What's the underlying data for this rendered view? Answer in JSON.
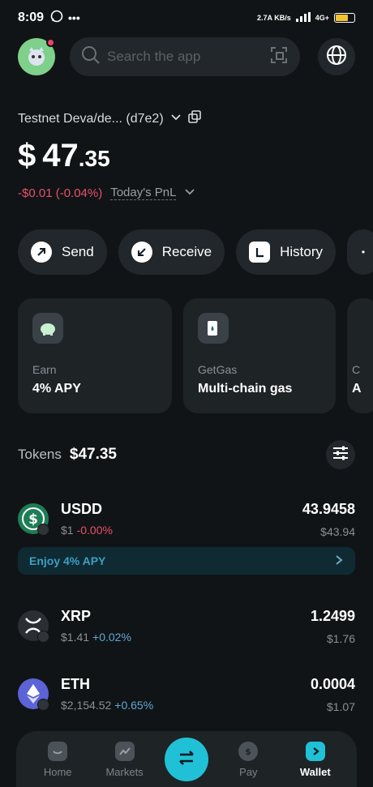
{
  "status_bar": {
    "time": "8:09",
    "net_speed": "2.7A KB/s",
    "network": "4G+"
  },
  "search": {
    "placeholder": "Search the app"
  },
  "account": {
    "name": "Testnet Deva/de... (d7e2)"
  },
  "balance": {
    "currency": "$",
    "integer": "47",
    "decimal": ".35"
  },
  "pnl": {
    "value": "-$0.01 (-0.04%)",
    "label": "Today's PnL"
  },
  "actions": [
    {
      "label": "Send"
    },
    {
      "label": "Receive"
    },
    {
      "label": "History"
    }
  ],
  "cards": [
    {
      "title": "Earn",
      "value": "4%  APY"
    },
    {
      "title": "GetGas",
      "value": "Multi-chain gas"
    },
    {
      "title": "C",
      "value": "A"
    }
  ],
  "tokens": {
    "label": "Tokens",
    "total": "$47.35",
    "items": [
      {
        "symbol": "USDD",
        "price": "$1",
        "change": "-0.00%",
        "change_dir": "neg",
        "qty": "43.9458",
        "value": "$43.94"
      },
      {
        "symbol": "XRP",
        "price": "$1.41",
        "change": "+0.02%",
        "change_dir": "pos",
        "qty": "1.2499",
        "value": "$1.76"
      },
      {
        "symbol": "ETH",
        "price": "$2,154.52",
        "change": "+0.65%",
        "change_dir": "pos",
        "qty": "0.0004",
        "value": "$1.07"
      }
    ]
  },
  "promo": {
    "label": "Enjoy 4% APY"
  },
  "tabbar": {
    "items": [
      {
        "label": "Home"
      },
      {
        "label": "Markets"
      },
      {
        "label": "Pay"
      },
      {
        "label": "Wallet"
      }
    ]
  },
  "colors": {
    "accent": "#20c1d6",
    "negative": "#e8506a",
    "positive": "#5fa8d8",
    "background": "#111416"
  }
}
